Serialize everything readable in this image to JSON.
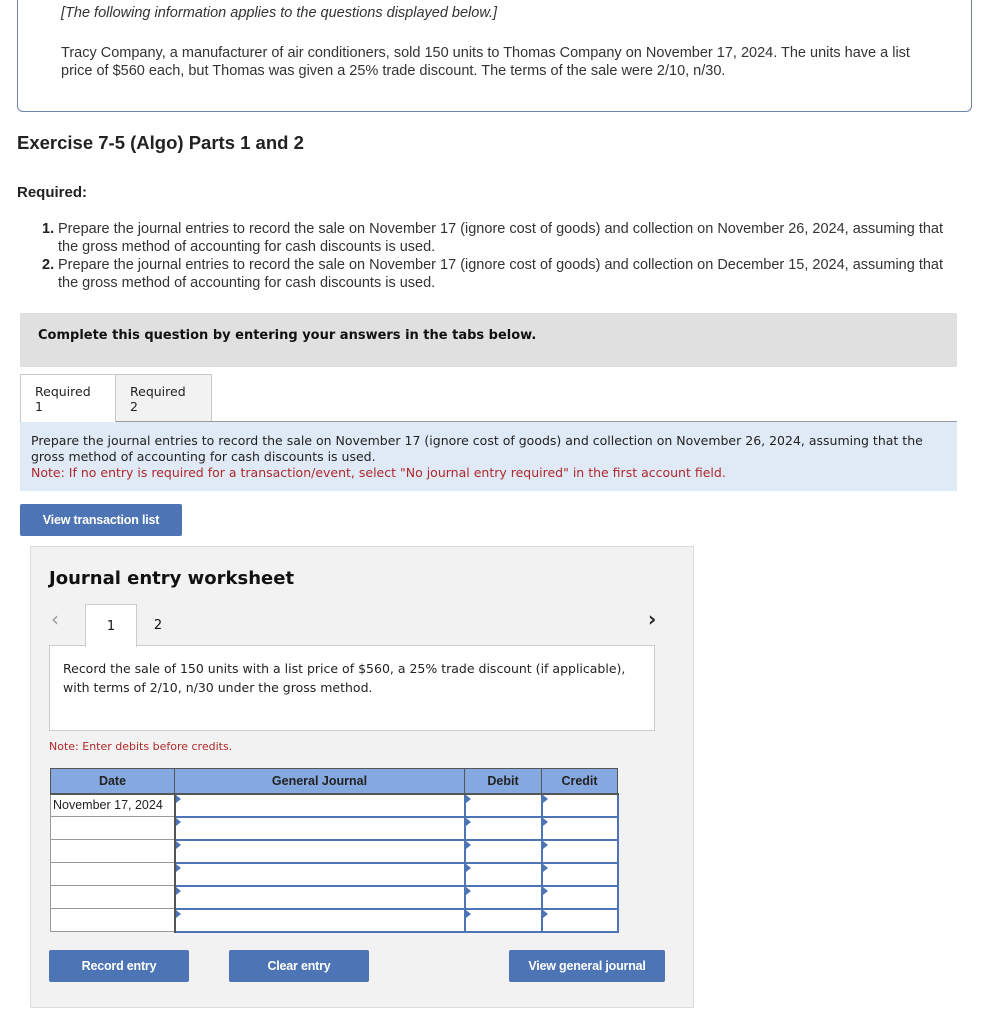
{
  "info": {
    "intro": "[The following information applies to the questions displayed below.]",
    "text": "Tracy Company, a manufacturer of air conditioners, sold 150 units to Thomas Company on November 17, 2024. The units have a list price of $560 each, but Thomas was given a 25% trade discount. The terms of the sale were 2/10, n/30."
  },
  "exercise_title": "Exercise 7-5 (Algo) Parts 1 and 2",
  "required": {
    "heading": "Required:",
    "items": [
      {
        "num": "1.",
        "text": "Prepare the journal entries to record the sale on November 17 (ignore cost of goods) and collection on November 26, 2024, assuming that the gross method of accounting for cash discounts is used."
      },
      {
        "num": "2.",
        "text": "Prepare the journal entries to record the sale on November 17 (ignore cost of goods) and collection on December 15, 2024, assuming that the gross method of accounting for cash discounts is used."
      }
    ]
  },
  "complete_banner": "Complete this question by entering your answers in the tabs below.",
  "tabs": [
    {
      "label": "Required 1",
      "active": true
    },
    {
      "label": "Required 2",
      "active": false
    }
  ],
  "instructions": {
    "text": "Prepare the journal entries to record the sale on November 17 (ignore cost of goods) and collection on November 26, 2024, assuming that the gross method of accounting for cash discounts is used.",
    "note": "Note: If no entry is required for a transaction/event, select \"No journal entry required\" in the first account field."
  },
  "buttons": {
    "view_transaction_list": "View transaction list",
    "record_entry": "Record entry",
    "clear_entry": "Clear entry",
    "view_general_journal": "View general journal"
  },
  "worksheet": {
    "title": "Journal entry worksheet",
    "prev_icon": "‹",
    "next_icon": "›",
    "tabs": [
      "1",
      "2"
    ],
    "active_tab": "1",
    "description": "Record the sale of 150 units with a list price of $560, a 25% trade discount (if applicable), with terms of 2/10, n/30 under the gross method.",
    "note": "Note: Enter debits before credits.",
    "table": {
      "headers": {
        "date": "Date",
        "journal": "General Journal",
        "debit": "Debit",
        "credit": "Credit"
      },
      "rows": [
        {
          "date": "November 17, 2024",
          "account": "",
          "debit": "",
          "credit": ""
        },
        {
          "date": "",
          "account": "",
          "debit": "",
          "credit": ""
        },
        {
          "date": "",
          "account": "",
          "debit": "",
          "credit": ""
        },
        {
          "date": "",
          "account": "",
          "debit": "",
          "credit": ""
        },
        {
          "date": "",
          "account": "",
          "debit": "",
          "credit": ""
        },
        {
          "date": "",
          "account": "",
          "debit": "",
          "credit": ""
        }
      ]
    }
  },
  "colors": {
    "button_blue": "#4d74b4",
    "table_header_blue": "#86a8e0",
    "note_red": "#b0282a",
    "instruction_bg": "#dfeaf6",
    "banner_gray": "#e0e0e0"
  }
}
